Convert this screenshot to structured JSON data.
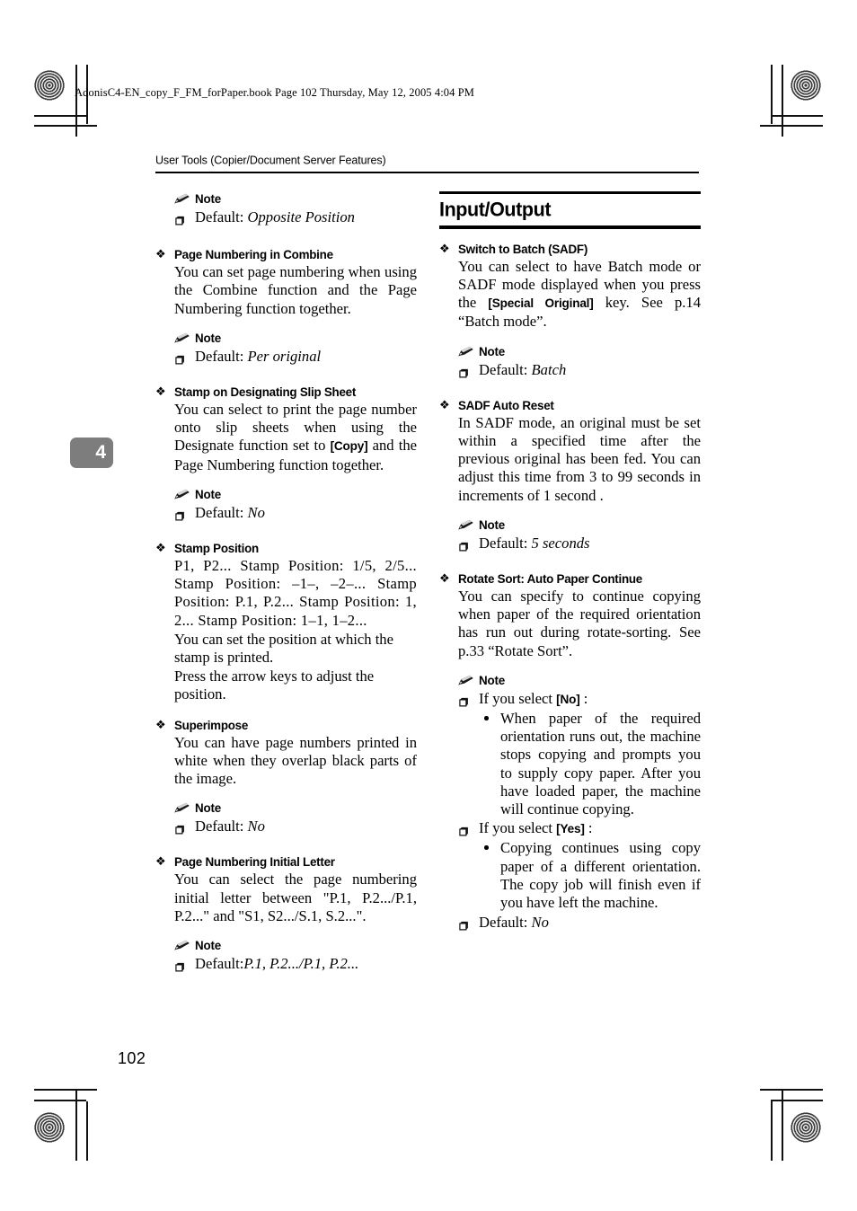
{
  "print_marks": {
    "file_stamp": "AdonisC4-EN_copy_F_FM_forPaper.book  Page 102  Thursday, May 12, 2005  4:04 PM"
  },
  "running_header": {
    "text": "User Tools (Copier/Document Server Features)"
  },
  "chapter_tab": {
    "number": "4"
  },
  "page_number": "102",
  "left_column": {
    "orphan_note": {
      "head": "Note",
      "items": [
        {
          "prefix": "Default: ",
          "value": "Opposite Position"
        }
      ]
    },
    "sections": [
      {
        "heading": "Page Numbering in Combine",
        "paragraphs": [
          "You can set page numbering when using the Combine function and the Page Numbering function together."
        ],
        "note": {
          "head": "Note",
          "items": [
            {
              "prefix": "Default: ",
              "value": "Per original"
            }
          ]
        }
      },
      {
        "heading": "Stamp on Designating Slip Sheet",
        "paragraph_rich": {
          "before": "You can select to print the page number onto slip sheets when using the Designate function set to ",
          "key": "[Copy]",
          "after": " and the Page Numbering function together."
        },
        "note": {
          "head": "Note",
          "items": [
            {
              "prefix": "Default: ",
              "value": "No"
            }
          ]
        }
      },
      {
        "heading": "Stamp Position",
        "paragraphs": [
          "P1, P2... Stamp Position: 1/5, 2/5... Stamp Position: –1–, –2–... Stamp Position: P.1, P.2... Stamp Position: 1, 2... Stamp Position: 1–1, 1–2...",
          "You can set the position at which the stamp is printed.",
          "Press the arrow keys to adjust the position."
        ]
      },
      {
        "heading": "Superimpose",
        "paragraphs": [
          "You can have page numbers printed in white when they overlap black parts of the image."
        ],
        "note": {
          "head": "Note",
          "items": [
            {
              "prefix": "Default: ",
              "value": "No"
            }
          ]
        }
      },
      {
        "heading": "Page Numbering Initial Letter",
        "paragraphs": [
          "You can select the page numbering initial letter between \"P.1, P.2.../P.1, P.2...\" and \"S1, S2.../S.1, S.2...\"."
        ],
        "note": {
          "head": "Note",
          "items": [
            {
              "prefix": "Default:",
              "value": "P.1, P.2.../P.1, P.2..."
            }
          ]
        }
      }
    ]
  },
  "right_column": {
    "banner_title": "Input/Output",
    "sections": [
      {
        "heading": "Switch to Batch (SADF)",
        "paragraph_rich": {
          "before": "You can select to have Batch mode or SADF mode displayed when you press the ",
          "key": "[Special Original]",
          "after": " key. See p.14 “Batch mode”."
        },
        "note": {
          "head": "Note",
          "items": [
            {
              "prefix": "Default: ",
              "value": "Batch"
            }
          ]
        }
      },
      {
        "heading": "SADF Auto Reset",
        "paragraphs": [
          "In SADF mode, an original must be set within a specified time after the previous original has been fed. You can adjust this time from 3 to 99 seconds in increments of 1 second ."
        ],
        "note": {
          "head": "Note",
          "items": [
            {
              "prefix": "Default: ",
              "value": "5 seconds"
            }
          ]
        }
      },
      {
        "heading": "Rotate Sort: Auto Paper Continue",
        "paragraphs": [
          "You can specify to continue copying when paper of the required orientation has run out during rotate-sorting. See p.33 “Rotate Sort”."
        ],
        "note": {
          "head": "Note",
          "entry_no": {
            "before": "If you select ",
            "key": "[No]",
            "after": " :"
          },
          "bullet_no": "When paper of the required orientation runs out, the machine stops copying and prompts you to supply copy paper. After you have loaded paper, the machine will continue copying.",
          "entry_yes": {
            "before": "If you select ",
            "key": "[Yes]",
            "after": " :"
          },
          "bullet_yes": "Copying continues using copy paper of a different orientation. The copy job will finish even if you have left the machine.",
          "default": {
            "prefix": "Default: ",
            "value": "No"
          }
        }
      }
    ]
  },
  "icons": {
    "diamond": "❖",
    "square": "square-icon",
    "pencil": "pencil-icon",
    "dot": "dot-icon"
  }
}
